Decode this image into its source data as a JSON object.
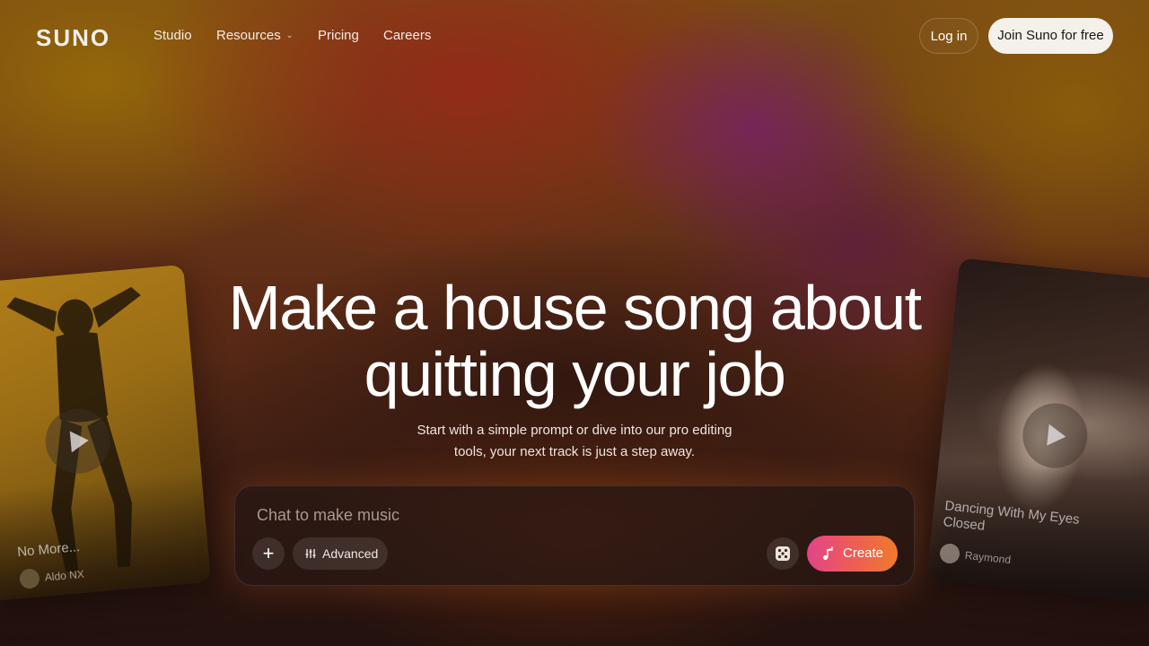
{
  "brand": {
    "logo": "SUNO"
  },
  "nav": {
    "links": [
      {
        "label": "Studio"
      },
      {
        "label": "Resources",
        "has_dropdown": true
      },
      {
        "label": "Pricing"
      },
      {
        "label": "Careers"
      }
    ],
    "login_label": "Log in",
    "join_label": "Join Suno for free"
  },
  "hero": {
    "title_line1": "Make a house song about",
    "title_line2": "quitting your job",
    "subtitle_line1": "Start with a simple prompt or dive into our pro editing",
    "subtitle_line2": "tools, your next track is just a step away."
  },
  "prompt": {
    "placeholder": "Chat to make music",
    "value": "",
    "add_icon": "plus-icon",
    "advanced_label": "Advanced",
    "advanced_icon": "sliders-icon",
    "random_icon": "dice-icon",
    "create_label": "Create",
    "create_icon": "music-note-icon"
  },
  "cards": {
    "left": {
      "title": "No More...",
      "artist": "Aldo NX"
    },
    "right": {
      "title": "Dancing With My Eyes Closed",
      "artist": "Raymond"
    }
  },
  "colors": {
    "create_gradient_start": "#e2448a",
    "create_gradient_end": "#f07a2c",
    "join_button_bg": "#f4f0ea"
  }
}
